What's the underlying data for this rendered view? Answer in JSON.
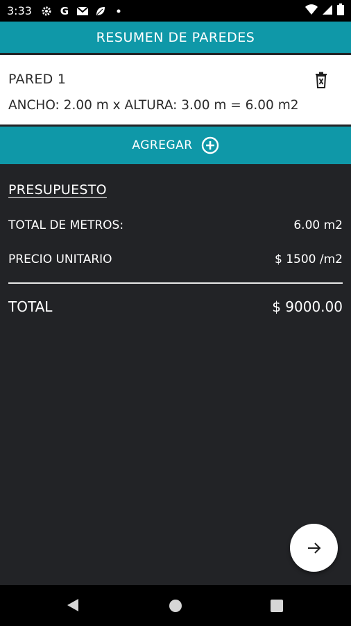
{
  "status_bar": {
    "time": "3:33",
    "icons": [
      "gear-icon",
      "google-g-icon",
      "gmail-icon",
      "leaf-icon",
      "dot-icon",
      "wifi-icon",
      "signal-icon",
      "battery-icon"
    ],
    "google_letter": "G"
  },
  "header": {
    "title": "RESUMEN DE PAREDES",
    "color": "#0f98a8"
  },
  "walls": [
    {
      "name": "PARED 1",
      "dimensions": "ANCHO: 2.00 m x ALTURA: 3.00 m = 6.00 m2"
    }
  ],
  "add_button": {
    "label": "AGREGAR"
  },
  "budget": {
    "title": "PRESUPUESTO",
    "total_meters_label": "TOTAL DE METROS:",
    "total_meters_value": "6.00 m2",
    "unit_price_label": "PRECIO UNITARIO",
    "unit_price_value": "$ 1500 /m2",
    "total_label": "TOTAL",
    "total_value": "$ 9000.00"
  },
  "fab": {
    "icon": "arrow-right-icon"
  },
  "nav_bar": {
    "icons": [
      "back-icon",
      "home-icon",
      "recents-icon"
    ]
  }
}
